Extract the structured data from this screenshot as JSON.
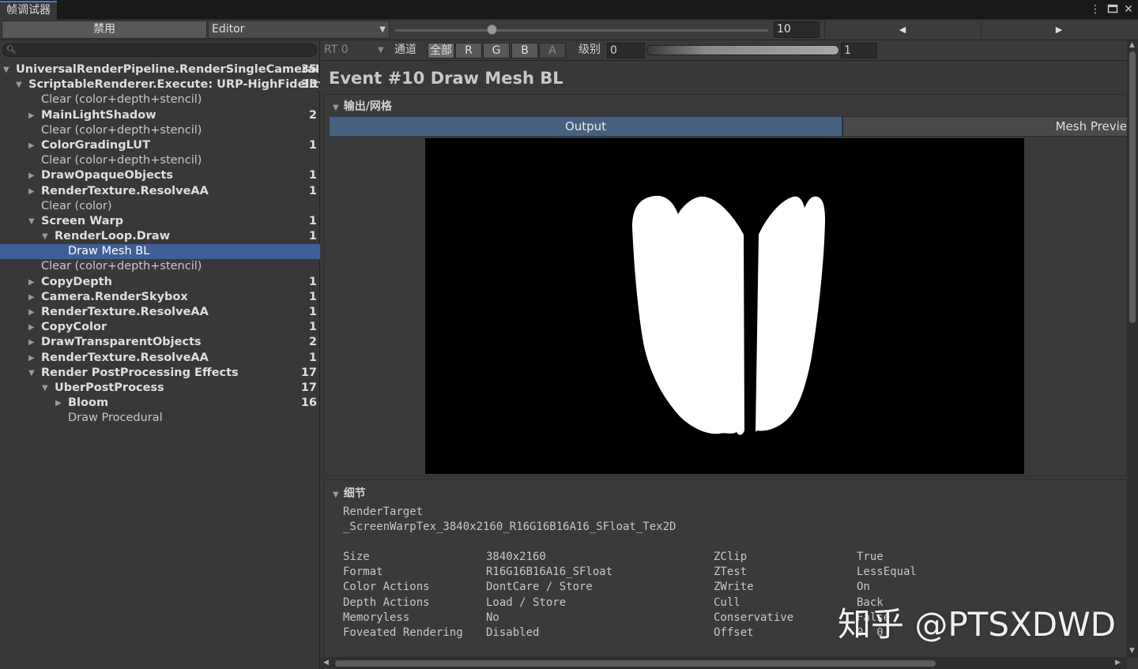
{
  "window": {
    "tab_title": "帧调试器",
    "menu_icon": "kebab-menu-icon",
    "maximize_icon": "maximize-icon",
    "close_icon": "close-icon"
  },
  "toolbar": {
    "disable_label": "禁用",
    "target_dropdown": "Editor",
    "event_number": "10",
    "event_total_ratio": 0.26
  },
  "left": {
    "search_placeholder": "",
    "tree": [
      {
        "label": "UniversalRenderPipeline.RenderSingleCameraInte",
        "count": "35",
        "bold": true,
        "toggle": "expanded",
        "depth": 0
      },
      {
        "label": "ScriptableRenderer.Execute: URP-HighFidelity-F",
        "count": "35",
        "bold": true,
        "toggle": "expanded",
        "depth": 1
      },
      {
        "label": "Clear (color+depth+stencil)",
        "count": "",
        "bold": false,
        "toggle": "none",
        "depth": 2
      },
      {
        "label": "MainLightShadow",
        "count": "2",
        "bold": true,
        "toggle": "collapsed",
        "depth": 2
      },
      {
        "label": "Clear (color+depth+stencil)",
        "count": "",
        "bold": false,
        "toggle": "none",
        "depth": 2
      },
      {
        "label": "ColorGradingLUT",
        "count": "1",
        "bold": true,
        "toggle": "collapsed",
        "depth": 2
      },
      {
        "label": "Clear (color+depth+stencil)",
        "count": "",
        "bold": false,
        "toggle": "none",
        "depth": 2
      },
      {
        "label": "DrawOpaqueObjects",
        "count": "1",
        "bold": true,
        "toggle": "collapsed",
        "depth": 2
      },
      {
        "label": "RenderTexture.ResolveAA",
        "count": "1",
        "bold": true,
        "toggle": "collapsed",
        "depth": 2
      },
      {
        "label": "Clear (color)",
        "count": "",
        "bold": false,
        "toggle": "none",
        "depth": 2
      },
      {
        "label": "Screen Warp",
        "count": "1",
        "bold": true,
        "toggle": "expanded",
        "depth": 2
      },
      {
        "label": "RenderLoop.Draw",
        "count": "1",
        "bold": true,
        "toggle": "expanded",
        "depth": 3
      },
      {
        "label": "Draw Mesh BL",
        "count": "",
        "bold": false,
        "toggle": "none",
        "depth": 4,
        "selected": true
      },
      {
        "label": "Clear (color+depth+stencil)",
        "count": "",
        "bold": false,
        "toggle": "none",
        "depth": 2
      },
      {
        "label": "CopyDepth",
        "count": "1",
        "bold": true,
        "toggle": "collapsed",
        "depth": 2
      },
      {
        "label": "Camera.RenderSkybox",
        "count": "1",
        "bold": true,
        "toggle": "collapsed",
        "depth": 2
      },
      {
        "label": "RenderTexture.ResolveAA",
        "count": "1",
        "bold": true,
        "toggle": "collapsed",
        "depth": 2
      },
      {
        "label": "CopyColor",
        "count": "1",
        "bold": true,
        "toggle": "collapsed",
        "depth": 2
      },
      {
        "label": "DrawTransparentObjects",
        "count": "2",
        "bold": true,
        "toggle": "collapsed",
        "depth": 2
      },
      {
        "label": "RenderTexture.ResolveAA",
        "count": "1",
        "bold": true,
        "toggle": "collapsed",
        "depth": 2
      },
      {
        "label": "Render PostProcessing Effects",
        "count": "17",
        "bold": true,
        "toggle": "expanded",
        "depth": 2
      },
      {
        "label": "UberPostProcess",
        "count": "17",
        "bold": true,
        "toggle": "expanded",
        "depth": 3
      },
      {
        "label": "Bloom",
        "count": "16",
        "bold": true,
        "toggle": "collapsed",
        "depth": 4
      },
      {
        "label": "Draw Procedural",
        "count": "",
        "bold": false,
        "toggle": "none",
        "depth": 4
      }
    ]
  },
  "right": {
    "rt_dropdown": "RT 0",
    "channel_label": "通道",
    "channels": [
      {
        "label": "全部",
        "state": "on"
      },
      {
        "label": "R",
        "state": "normal"
      },
      {
        "label": "G",
        "state": "normal"
      },
      {
        "label": "B",
        "state": "normal"
      },
      {
        "label": "A",
        "state": "dim"
      }
    ],
    "level_label": "级别",
    "level_min": "0",
    "level_max": "1",
    "event_title": "Event #10 Draw Mesh BL",
    "output_section": "输出/网格",
    "tab_output": "Output",
    "tab_mesh": "Mesh Previe",
    "details_section": "细节",
    "render_target_label": "RenderTarget",
    "render_target_name": "_ScreenWarpTex_3840x2160_R16G16B16A16_SFloat_Tex2D",
    "props_left": [
      {
        "k": "Size",
        "v": "3840x2160"
      },
      {
        "k": "Format",
        "v": "R16G16B16A16_SFloat"
      },
      {
        "k": "Color Actions",
        "v": "DontCare / Store"
      },
      {
        "k": "Depth Actions",
        "v": "Load / Store"
      },
      {
        "k": "Memoryless",
        "v": "No"
      },
      {
        "k": "Foveated Rendering",
        "v": "Disabled"
      }
    ],
    "props_right": [
      {
        "k": "ZClip",
        "v": "True"
      },
      {
        "k": "ZTest",
        "v": "LessEqual"
      },
      {
        "k": "ZWrite",
        "v": "On"
      },
      {
        "k": "Cull",
        "v": "Back"
      },
      {
        "k": "Conservative",
        "v": "False"
      },
      {
        "k": "Offset",
        "v": "0, 0"
      }
    ]
  },
  "watermark": "知乎 @PTSXDWD",
  "colors": {
    "accent": "#4d78cc",
    "selection": "#3e5f96",
    "active_tab": "#46607f",
    "panel": "#383838"
  }
}
